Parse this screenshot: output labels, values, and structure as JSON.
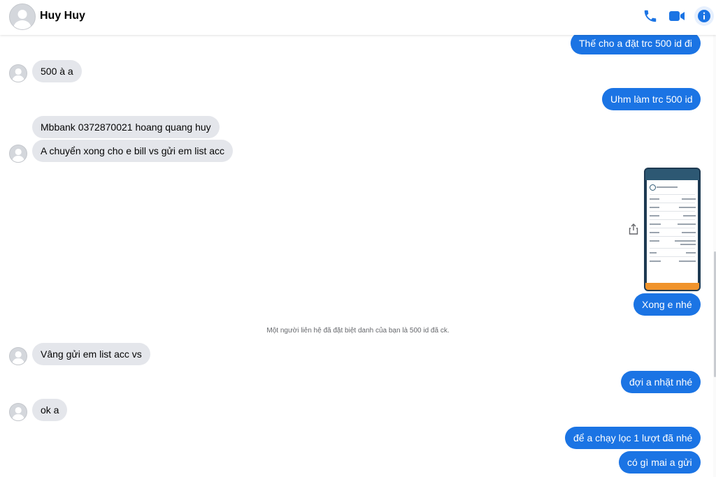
{
  "header": {
    "contact_name": "Huy Huy",
    "icons": [
      "phone-icon",
      "video-icon",
      "info-icon"
    ],
    "accent_color": "#1b74e4"
  },
  "messages": {
    "m1": "Thế cho a đặt trc 500 id đi",
    "m2": "500 à a",
    "m3": "Uhm làm trc 500 id",
    "m4": "Mbbank 0372870021 hoang quang huy",
    "m5": "A chuyển xong cho e bill vs gửi em list acc",
    "m6": "Xong e nhé",
    "m7": "Vâng gửi em list acc vs",
    "m8": "đợi a nhặt nhé",
    "m9": "ok a",
    "m10": "để a chạy lọc 1 lượt đã nhé",
    "m11": "có gì mai a gửi"
  },
  "system_notice": "Một người liên hệ đã đặt biệt danh của bạn là 500 id đã ck.",
  "colors": {
    "outgoing_bubble": "#1b74e4",
    "incoming_bubble": "#e4e6eb"
  }
}
